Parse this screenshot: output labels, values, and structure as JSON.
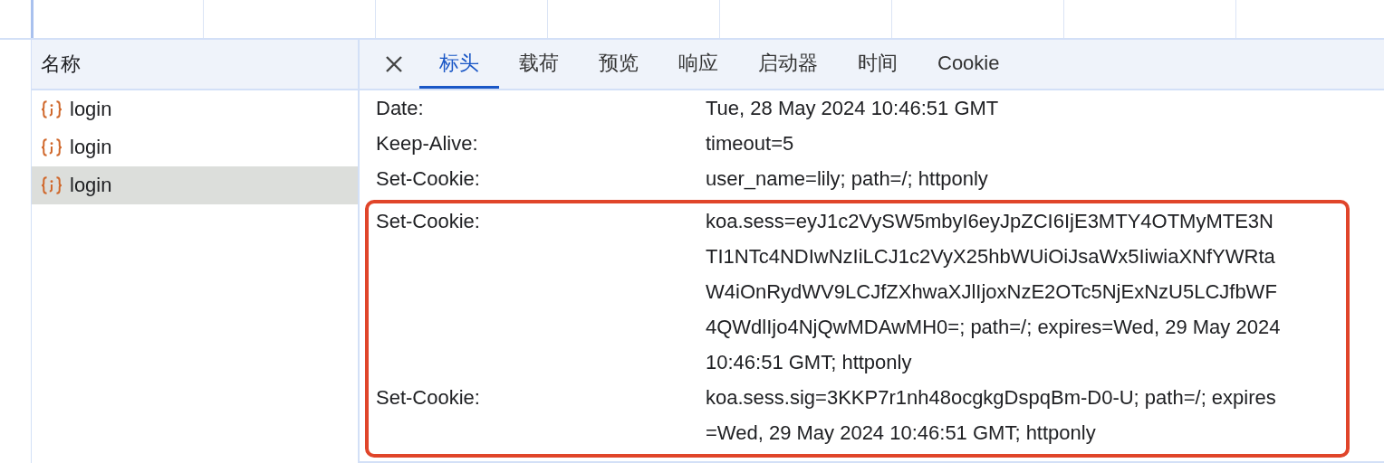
{
  "requests": {
    "column_title": "名称",
    "items": [
      {
        "name": "login",
        "selected": false
      },
      {
        "name": "login",
        "selected": false
      },
      {
        "name": "login",
        "selected": true
      }
    ]
  },
  "details": {
    "tabs": [
      {
        "label": "标头",
        "selected": true
      },
      {
        "label": "载荷",
        "selected": false
      },
      {
        "label": "预览",
        "selected": false
      },
      {
        "label": "响应",
        "selected": false
      },
      {
        "label": "启动器",
        "selected": false
      },
      {
        "label": "时间",
        "selected": false
      },
      {
        "label": "Cookie",
        "selected": false
      }
    ],
    "headers": [
      {
        "name": "Date:",
        "value": "Tue, 28 May 2024 10:46:51 GMT",
        "highlighted": false
      },
      {
        "name": "Keep-Alive:",
        "value": "timeout=5",
        "highlighted": false
      },
      {
        "name": "Set-Cookie:",
        "value": "user_name=lily; path=/; httponly",
        "highlighted": false
      },
      {
        "name": "Set-Cookie:",
        "value": "koa.sess=eyJ1c2VySW5mbyI6eyJpZCI6IjE3MTY4OTMyMTE3NTI1NTc4NDIwNzIiLCJ1c2VyX25hbWUiOiJsaWx5IiwiaXNfYWRtaW4iOnRydWV9LCJfZXhwaXJlIjoxNzE2OTc5NjExNzU5LCJfbWF4QWdlIjo4NjQwMDAwMH0=; path=/; expires=Wed, 29 May 2024 10:46:51 GMT; httponly",
        "highlighted": true
      },
      {
        "name": "Set-Cookie:",
        "value": "koa.sess.sig=3KKP7r1nh48ocgkgDspqBm-D0-U; path=/; expires=Wed, 29 May 2024 10:46:51 GMT; httponly",
        "highlighted": true
      }
    ]
  }
}
